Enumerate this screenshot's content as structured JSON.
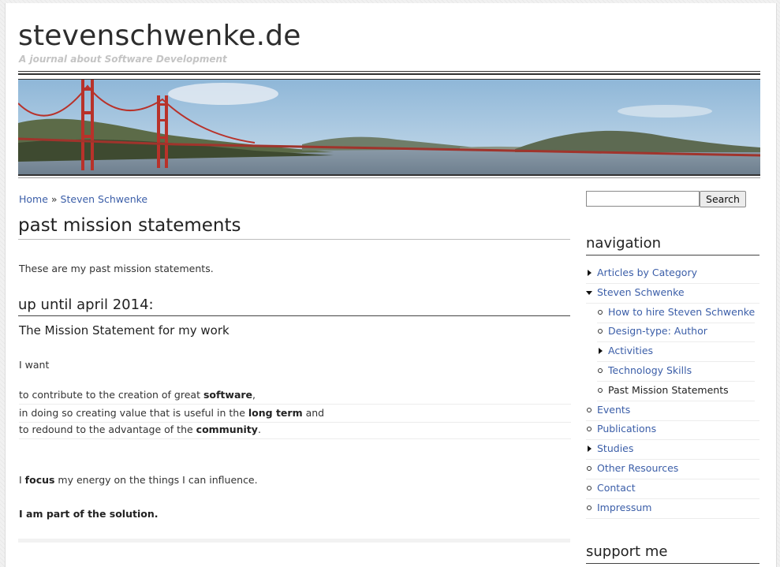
{
  "site": {
    "title": "stevenschwenke.de",
    "slogan": "A journal about Software Development"
  },
  "breadcrumb": {
    "home": "Home",
    "separator": "»",
    "current": "Steven Schwenke"
  },
  "page": {
    "title": "past mission statements",
    "intro": "These are my past mission statements.",
    "section_heading": "up until april 2014:",
    "sub_heading": "The Mission Statement for my work",
    "i_want": "I want",
    "lines": [
      {
        "pre": "to contribute to the creation of great ",
        "bold": "software",
        "post": ","
      },
      {
        "pre": "in doing so creating value that is useful in the ",
        "bold": "long term",
        "post": " and"
      },
      {
        "pre": "to redound to the advantage of the ",
        "bold": "community",
        "post": "."
      }
    ],
    "focus": {
      "pre": "I ",
      "bold": "focus",
      "post": " my energy on the things I can influence."
    },
    "closing": "I am part of the solution."
  },
  "search": {
    "placeholder": "",
    "button_label": "Search"
  },
  "navigation": {
    "title": "navigation",
    "items": [
      {
        "label": "Articles by Category",
        "state": "collapsed",
        "level": 0
      },
      {
        "label": "Steven Schwenke",
        "state": "expanded",
        "level": 0
      },
      {
        "label": "How to hire Steven Schwenke",
        "state": "leaf",
        "level": 1
      },
      {
        "label": "Design-type: Author",
        "state": "leaf",
        "level": 1
      },
      {
        "label": "Activities",
        "state": "collapsed",
        "level": 1
      },
      {
        "label": "Technology Skills",
        "state": "leaf",
        "level": 1
      },
      {
        "label": "Past Mission Statements",
        "state": "leaf",
        "level": 1,
        "active": true
      },
      {
        "label": "Events",
        "state": "leaf",
        "level": 0
      },
      {
        "label": "Publications",
        "state": "leaf",
        "level": 0
      },
      {
        "label": "Studies",
        "state": "collapsed",
        "level": 0
      },
      {
        "label": "Other Resources",
        "state": "leaf",
        "level": 0
      },
      {
        "label": "Contact",
        "state": "leaf",
        "level": 0
      },
      {
        "label": "Impressum",
        "state": "leaf",
        "level": 0
      }
    ]
  },
  "support": {
    "title": "support me"
  },
  "colors": {
    "link": "#3b5ea8",
    "text": "#333333",
    "slogan": "#c4c4c4"
  }
}
